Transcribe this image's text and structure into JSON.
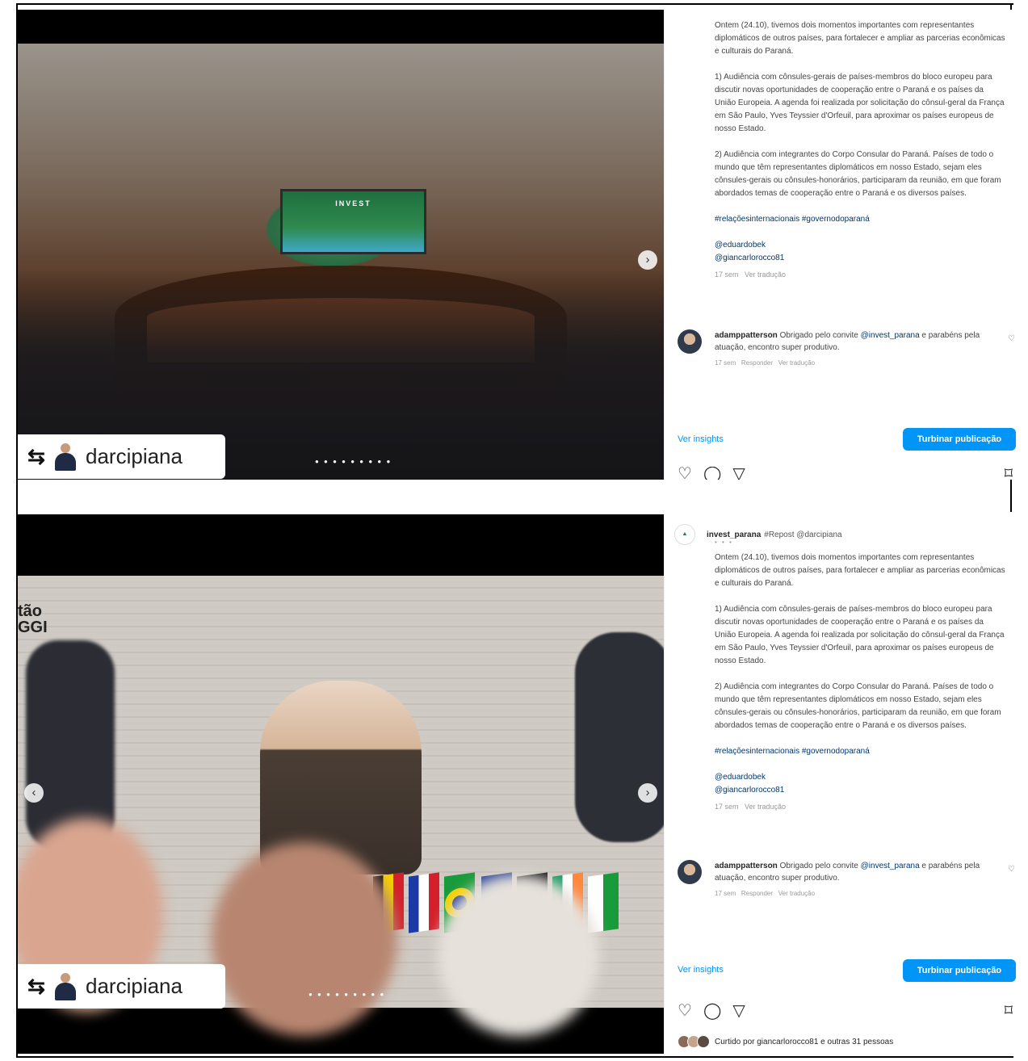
{
  "repost": {
    "icon": "repost-icon",
    "username": "darcipiana"
  },
  "post": {
    "account": "invest_parana",
    "repost_tag": "#Repost @darcipiana",
    "screen_logo": "INVEST",
    "caption_p1": "Ontem (24.10), tivemos dois momentos importantes com representantes diplomáticos de outros países, para fortalecer e ampliar as parcerias econômicas e culturais do Paraná.",
    "caption_p2": "1) Audiência com cônsules-gerais de países-membros do bloco europeu para discutir novas oportunidades de cooperação entre o Paraná e os países da União Europeia. A agenda foi realizada por solicitação do cônsul-geral da França em São Paulo, Yves Teyssier d'Orfeuil, para aproximar os países europeus de nosso Estado.",
    "caption_p3": "2) Audiência com integrantes do Corpo Consular do Paraná. Países de todo o mundo que têm representantes diplomáticos em nosso Estado, sejam eles cônsules-gerais ou cônsules-honorários, participaram da reunião, em que foram abordados temas de cooperação entre o Paraná e os diversos países.",
    "hashtags": "#relaçõesinternacionais #governodoparaná",
    "mention1": "@eduardobek",
    "mention2": "@giancarlorocco81",
    "time": "17 sem",
    "translate": "Ver tradução",
    "photo2_wall_text": "tão\nGGI"
  },
  "comment": {
    "username": "adamppatterson",
    "text_before": "Obrigado pelo convite",
    "mention": "@invest_parana",
    "text_after": "e parabéns pela atuação, encontro super produtivo.",
    "time": "17 sem",
    "reply": "Responder",
    "translate": "Ver tradução"
  },
  "actions": {
    "insights": "Ver insights",
    "boost": "Turbinar publicação",
    "likes": "Curtido por giancarlorocco81 e outras 31 pessoas",
    "like_icon": "heart-icon",
    "comment_icon": "comment-icon",
    "share_icon": "share-icon",
    "save_icon": "bookmark-icon"
  }
}
